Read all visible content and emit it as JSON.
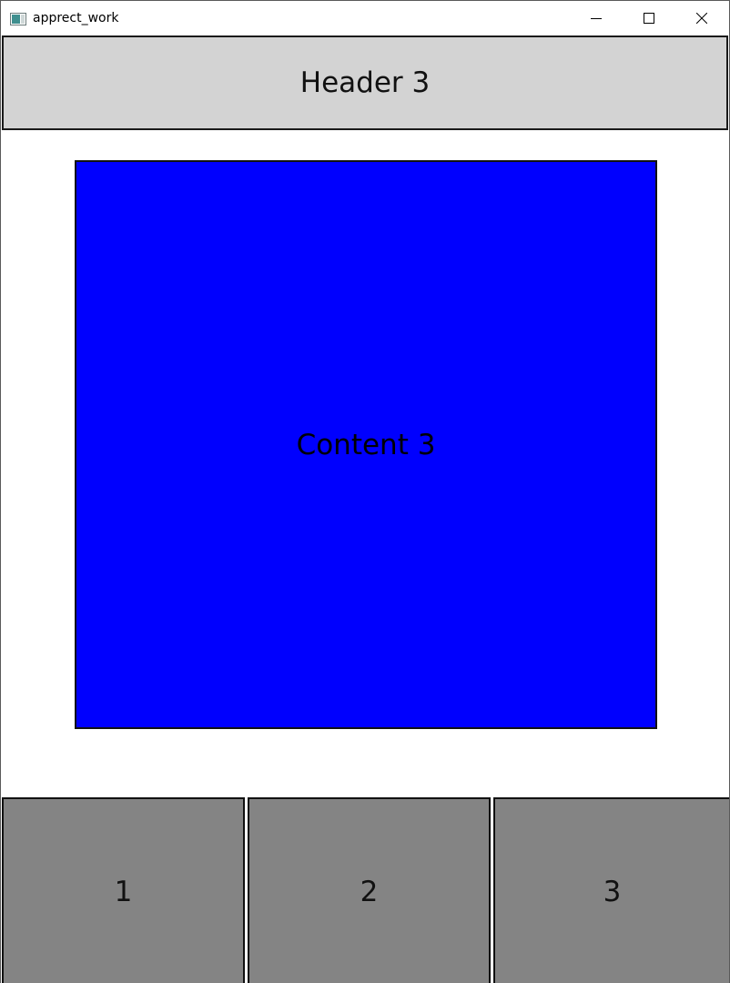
{
  "window": {
    "title": "apprect_work",
    "icon": "app-window-icon",
    "controls": {
      "minimize_icon": "minimize-icon",
      "maximize_icon": "maximize-icon",
      "close_icon": "close-icon"
    }
  },
  "header": {
    "label": "Header 3",
    "background": "#d3d3d3"
  },
  "content": {
    "label": "Content 3",
    "background": "#0000fe"
  },
  "tabs": [
    {
      "label": "1",
      "background": "#848484"
    },
    {
      "label": "2",
      "background": "#848484"
    },
    {
      "label": "3",
      "background": "#848484"
    }
  ]
}
